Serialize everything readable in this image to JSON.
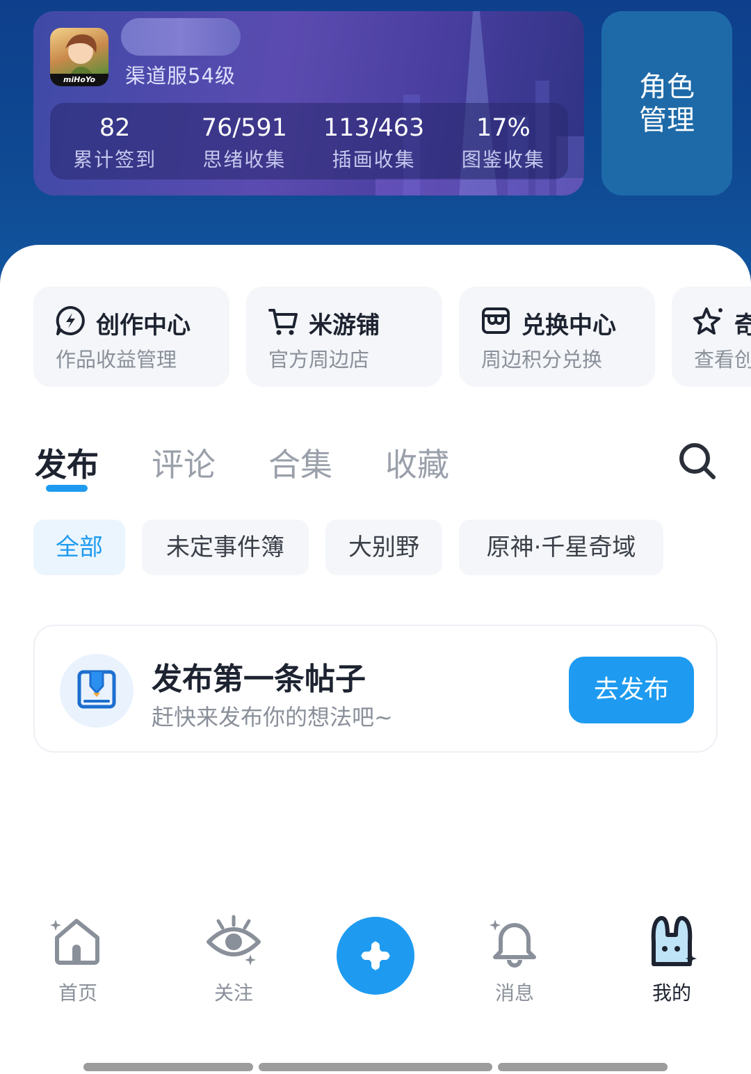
{
  "profile": {
    "game_brand": "miHoYo",
    "level_text": "渠道服54级",
    "stats": [
      {
        "value": "82",
        "label": "累计签到"
      },
      {
        "value": "76/591",
        "label": "思绪收集"
      },
      {
        "value": "113/463",
        "label": "插画收集"
      },
      {
        "value": "17%",
        "label": "图鉴收集"
      }
    ],
    "role_button": {
      "line1": "角色",
      "line2": "管理"
    }
  },
  "shortcuts": [
    {
      "title": "创作中心",
      "subtitle": "作品收益管理",
      "icon": "lightning-bubble-icon"
    },
    {
      "title": "米游铺",
      "subtitle": "官方周边店",
      "icon": "cart-icon"
    },
    {
      "title": "兑换中心",
      "subtitle": "周边积分兑换",
      "icon": "shop-icon"
    },
    {
      "title": "奇",
      "subtitle": "查看创",
      "icon": "sparkle-icon"
    }
  ],
  "tabs": [
    {
      "label": "发布",
      "active": true
    },
    {
      "label": "评论",
      "active": false
    },
    {
      "label": "合集",
      "active": false
    },
    {
      "label": "收藏",
      "active": false
    }
  ],
  "filters": [
    {
      "label": "全部",
      "active": true
    },
    {
      "label": "未定事件簿",
      "active": false
    },
    {
      "label": "大别野",
      "active": false
    },
    {
      "label": "原神·千星奇域",
      "active": false
    }
  ],
  "empty_post": {
    "title": "发布第一条帖子",
    "subtitle": "赶快来发布你的想法吧~",
    "button": "去发布"
  },
  "bottom_nav": [
    {
      "label": "首页",
      "icon": "home-icon",
      "active": false
    },
    {
      "label": "关注",
      "icon": "eye-icon",
      "active": false
    },
    {
      "label": "",
      "icon": "plus-icon",
      "active": false
    },
    {
      "label": "消息",
      "icon": "bell-icon",
      "active": false
    },
    {
      "label": "我的",
      "icon": "bunny-icon",
      "active": true
    }
  ],
  "colors": {
    "accent": "#1e9bf0",
    "top_background": "#0e3f8c",
    "card_purple": "#5b4bb0",
    "text_primary": "#1d2330",
    "text_secondary": "#8a909a"
  }
}
